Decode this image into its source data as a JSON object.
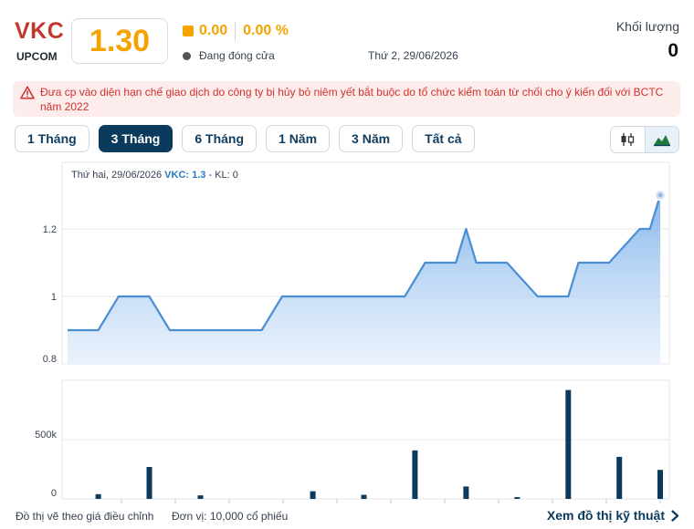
{
  "header": {
    "symbol": "VKC",
    "exchange": "UPCOM",
    "price": "1.30",
    "change": "0.00",
    "change_pct": "0.00 %",
    "status": "Đang đóng cửa",
    "date": "Thứ 2, 29/06/2026",
    "volume_label": "Khối lượng",
    "volume_value": "0"
  },
  "warning": {
    "icon": "warning-triangle-icon",
    "text": "Đưa cp vào diện hạn chế giao dịch do công ty bị hủy bỏ niêm yết bắt buộc do tổ chức kiểm toán từ chối cho ý kiến đối với BCTC năm 2022"
  },
  "range_tabs": [
    {
      "label": "1 Tháng",
      "active": false
    },
    {
      "label": "3 Tháng",
      "active": true
    },
    {
      "label": "6 Tháng",
      "active": false
    },
    {
      "label": "1 Năm",
      "active": false
    },
    {
      "label": "3 Năm",
      "active": false
    },
    {
      "label": "Tất cả",
      "active": false
    }
  ],
  "chart_type_toggle": [
    {
      "icon": "candlestick-icon",
      "active": false
    },
    {
      "icon": "mountain-chart-icon",
      "active": true
    }
  ],
  "tooltip": {
    "date": "Thứ hai, 29/06/2026",
    "symbol_label": "VKC: 1.3",
    "volume_text": "- KL: 0"
  },
  "chart_data": [
    {
      "type": "area",
      "name": "price",
      "ylim": [
        0.8,
        1.3
      ],
      "yticks": [
        "0.8",
        "1",
        "1.2"
      ],
      "ytick_values": [
        0.8,
        1.0,
        1.2
      ],
      "grid": true,
      "color": "#4a8fd6",
      "x": [
        0,
        3,
        5,
        8,
        10,
        13,
        19,
        21,
        33,
        35,
        38,
        39,
        40,
        43,
        46,
        49,
        50,
        53,
        56,
        57,
        58
      ],
      "values": [
        0.9,
        0.9,
        1.0,
        1.0,
        0.9,
        0.9,
        0.9,
        1.0,
        1.0,
        1.1,
        1.1,
        1.2,
        1.1,
        1.1,
        1.0,
        1.0,
        1.1,
        1.1,
        1.2,
        1.2,
        1.3
      ]
    },
    {
      "type": "bar",
      "name": "volume",
      "ylim": [
        0,
        940000
      ],
      "yticks": [
        "0",
        "500k"
      ],
      "ytick_values": [
        0,
        500000
      ],
      "color": "#0b3a5c",
      "x": [
        3,
        8,
        13,
        24,
        29,
        34,
        39,
        44,
        49,
        54,
        58
      ],
      "values": [
        40000,
        270000,
        30000,
        65000,
        35000,
        410000,
        105000,
        15000,
        920000,
        355000,
        245000
      ]
    }
  ],
  "footer": {
    "note": "Đồ thị vẽ theo giá điều chỉnh",
    "unit": "Đơn vị: 10,000 cổ phiếu",
    "link": "Xem đồ thị kỹ thuật",
    "link_icon": "chevron-right-icon"
  }
}
